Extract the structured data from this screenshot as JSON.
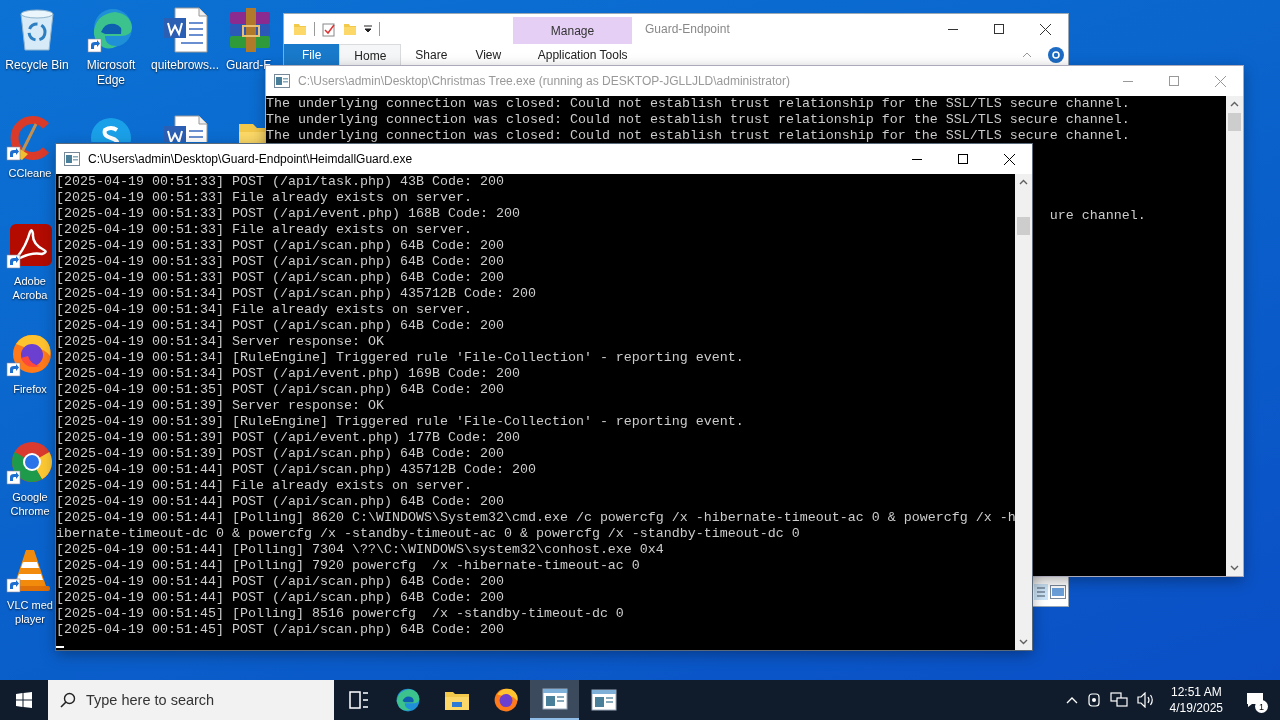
{
  "desktop": {
    "icon_columns": [
      [
        {
          "kind": "recycle",
          "label": "Recycle Bin"
        },
        {
          "kind": "ccleaner",
          "label": "CCleane"
        },
        {
          "kind": "acrobat",
          "label": "Adobe Acroba"
        },
        {
          "kind": "firefox",
          "label": "Firefox"
        },
        {
          "kind": "chrome",
          "label": "Google Chrome"
        },
        {
          "kind": "vlc",
          "label": "VLC med player"
        }
      ],
      [
        {
          "kind": "edge",
          "label": "Microsoft Edge"
        },
        {
          "kind": "skype"
        }
      ],
      [
        {
          "kind": "word",
          "label": "quitebrows..."
        },
        {
          "kind": "word"
        }
      ],
      [
        {
          "kind": "winrar",
          "label": "Guard-E"
        },
        {
          "kind": "folder"
        }
      ]
    ]
  },
  "explorer_window": {
    "title": "Guard-Endpoint",
    "contextual_group": "Manage",
    "tabs": [
      {
        "label": "File",
        "kind": "file",
        "selected": false
      },
      {
        "label": "Home",
        "kind": "normal",
        "selected": true
      },
      {
        "label": "Share",
        "kind": "normal",
        "selected": false
      },
      {
        "label": "View",
        "kind": "normal",
        "selected": false
      },
      {
        "label": "Application Tools",
        "kind": "contextual",
        "selected": false
      }
    ]
  },
  "consoles": [
    {
      "title": "C:\\Users\\admin\\Desktop\\Christmas Tree.exe (running as DESKTOP-JGLLJLD\\administrator)",
      "active": false,
      "lines": [
        {
          "kind": "full",
          "text": "The underlying connection was closed: Could not establish trust relationship for the SSL/TLS secure channel."
        },
        {
          "kind": "full",
          "text": "The underlying connection was closed: Could not establish trust relationship for the SSL/TLS secure channel."
        },
        {
          "kind": "full",
          "text": "The underlying connection was closed: Could not establish trust relationship for the SSL/TLS secure channel."
        },
        {
          "kind": "tail",
          "text": "ure channel."
        }
      ]
    },
    {
      "title": "C:\\Users\\admin\\Desktop\\Guard-Endpoint\\HeimdallGuard.exe",
      "active": true,
      "lines": [
        {
          "kind": "full",
          "text": "[2025-04-19 00:51:33] POST (/api/task.php) 43B Code: 200"
        },
        {
          "kind": "full",
          "text": "[2025-04-19 00:51:33] File already exists on server."
        },
        {
          "kind": "full",
          "text": "[2025-04-19 00:51:33] POST (/api/event.php) 168B Code: 200"
        },
        {
          "kind": "full",
          "text": "[2025-04-19 00:51:33] File already exists on server."
        },
        {
          "kind": "full",
          "text": "[2025-04-19 00:51:33] POST (/api/scan.php) 64B Code: 200"
        },
        {
          "kind": "full",
          "text": "[2025-04-19 00:51:33] POST (/api/scan.php) 64B Code: 200"
        },
        {
          "kind": "full",
          "text": "[2025-04-19 00:51:33] POST (/api/scan.php) 64B Code: 200"
        },
        {
          "kind": "full",
          "text": "[2025-04-19 00:51:34] POST (/api/scan.php) 435712B Code: 200"
        },
        {
          "kind": "full",
          "text": "[2025-04-19 00:51:34] File already exists on server."
        },
        {
          "kind": "full",
          "text": "[2025-04-19 00:51:34] POST (/api/scan.php) 64B Code: 200"
        },
        {
          "kind": "full",
          "text": "[2025-04-19 00:51:34] Server response: OK"
        },
        {
          "kind": "full",
          "text": "[2025-04-19 00:51:34] [RuleEngine] Triggered rule 'File-Collection' - reporting event."
        },
        {
          "kind": "full",
          "text": "[2025-04-19 00:51:34] POST (/api/event.php) 169B Code: 200"
        },
        {
          "kind": "full",
          "text": "[2025-04-19 00:51:35] POST (/api/scan.php) 64B Code: 200"
        },
        {
          "kind": "full",
          "text": "[2025-04-19 00:51:39] Server response: OK"
        },
        {
          "kind": "full",
          "text": "[2025-04-19 00:51:39] [RuleEngine] Triggered rule 'File-Collection' - reporting event."
        },
        {
          "kind": "full",
          "text": "[2025-04-19 00:51:39] POST (/api/event.php) 177B Code: 200"
        },
        {
          "kind": "full",
          "text": "[2025-04-19 00:51:39] POST (/api/scan.php) 64B Code: 200"
        },
        {
          "kind": "full",
          "text": "[2025-04-19 00:51:44] POST (/api/scan.php) 435712B Code: 200"
        },
        {
          "kind": "full",
          "text": "[2025-04-19 00:51:44] File already exists on server."
        },
        {
          "kind": "full",
          "text": "[2025-04-19 00:51:44] POST (/api/scan.php) 64B Code: 200"
        },
        {
          "kind": "full",
          "text": "[2025-04-19 00:51:44] [Polling] 8620 C:\\WINDOWS\\System32\\cmd.exe /c powercfg /x -hibernate-timeout-ac 0 & powercfg /x -hibernate-timeout-dc 0 & powercfg /x -standby-timeout-ac 0 & powercfg /x -standby-timeout-dc 0"
        },
        {
          "kind": "full",
          "text": "[2025-04-19 00:51:44] [Polling] 7304 \\??\\C:\\WINDOWS\\system32\\conhost.exe 0x4"
        },
        {
          "kind": "full",
          "text": "[2025-04-19 00:51:44] [Polling] 7920 powercfg  /x -hibernate-timeout-ac 0"
        },
        {
          "kind": "full",
          "text": "[2025-04-19 00:51:44] POST (/api/scan.php) 64B Code: 200"
        },
        {
          "kind": "full",
          "text": "[2025-04-19 00:51:44] POST (/api/scan.php) 64B Code: 200"
        },
        {
          "kind": "full",
          "text": "[2025-04-19 00:51:45] [Polling] 8516 powercfg  /x -standby-timeout-dc 0"
        },
        {
          "kind": "full",
          "text": "[2025-04-19 00:51:45] POST (/api/scan.php) 64B Code: 200"
        }
      ]
    }
  ],
  "taskbar": {
    "search": {
      "placeholder": "Type here to search"
    },
    "apps": [
      {
        "kind": "taskview",
        "selected": false
      },
      {
        "kind": "edge",
        "selected": false
      },
      {
        "kind": "explorer",
        "selected": false
      },
      {
        "kind": "firefox",
        "selected": false
      },
      {
        "kind": "console",
        "selected": true
      },
      {
        "kind": "console",
        "selected": false
      }
    ],
    "clock": {
      "time": "12:51 AM",
      "date": "4/19/2025"
    },
    "notifications": {
      "count": "1"
    }
  }
}
